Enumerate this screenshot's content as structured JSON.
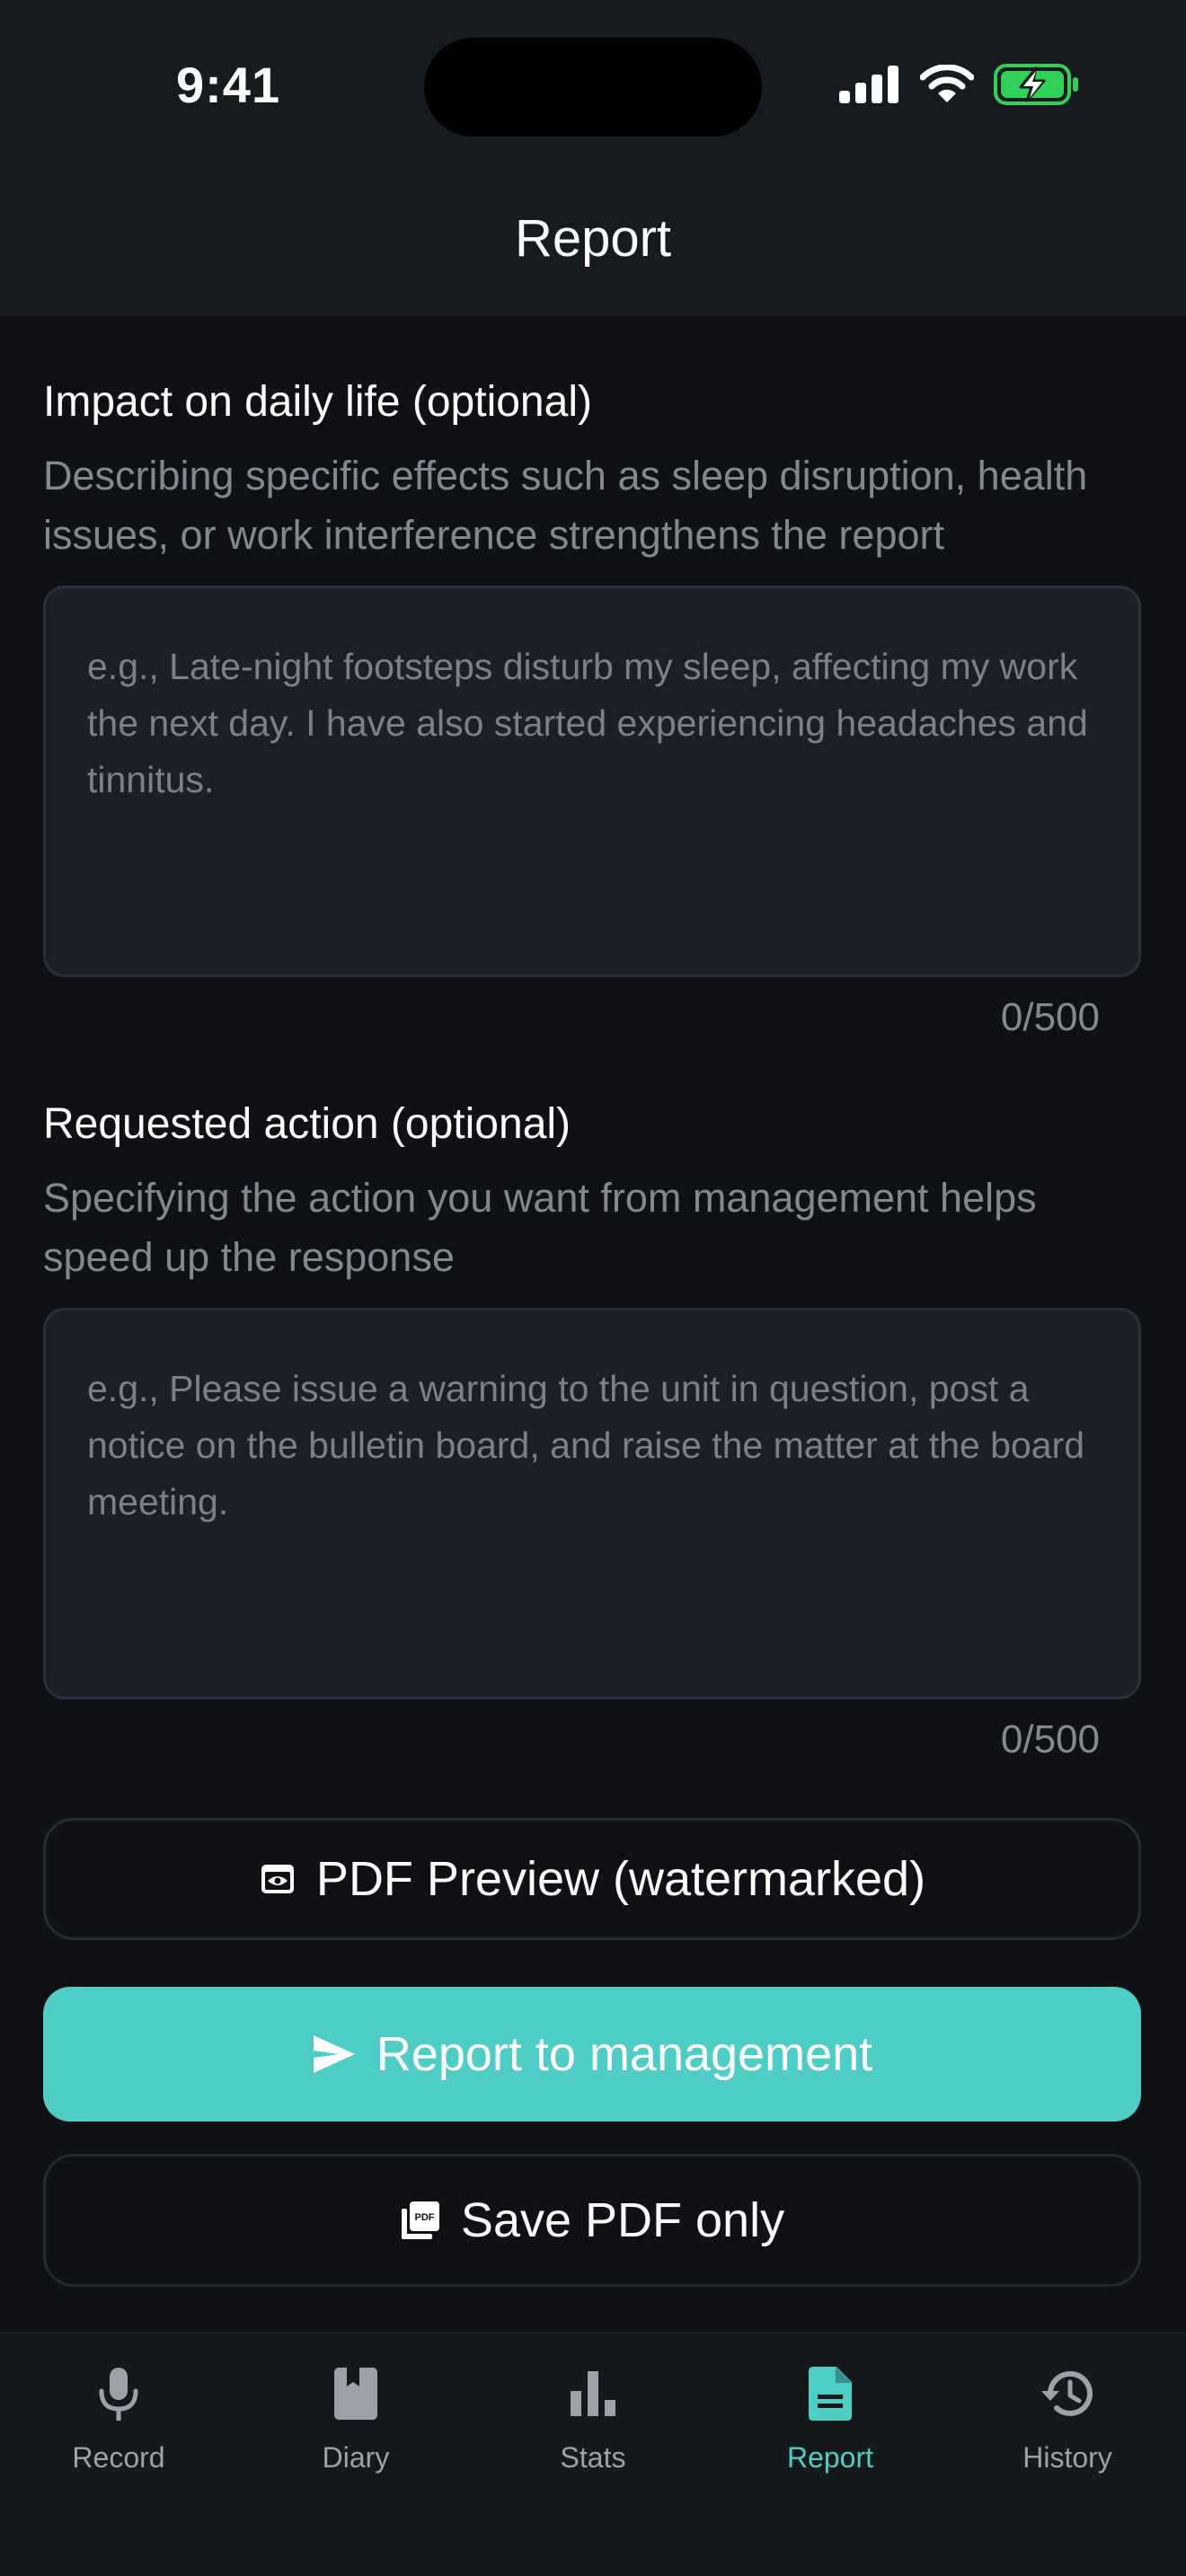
{
  "status_bar": {
    "time": "9:41"
  },
  "header": {
    "title": "Report"
  },
  "impact_section": {
    "title": "Impact on daily life (optional)",
    "help": "Describing specific effects such as sleep disruption, health issues, or work interference strengthens the report",
    "value": "",
    "placeholder": "e.g., Late-night footsteps disturb my sleep, affecting my work the next day. I have also started experiencing headaches and tinnitus.",
    "counter": "0/500"
  },
  "action_section": {
    "title": "Requested action (optional)",
    "help": "Specifying the action you want from management helps speed up the response",
    "value": "",
    "placeholder": "e.g., Please issue a warning to the unit in question, post a notice on the bulletin board, and raise the matter at the board meeting.",
    "counter": "0/500"
  },
  "buttons": {
    "preview": {
      "label": "PDF Preview (watermarked)",
      "icon": "eye-icon"
    },
    "report": {
      "label": "Report to management",
      "icon": "send-icon"
    },
    "save": {
      "label": "Save PDF only",
      "icon": "pdf-icon"
    }
  },
  "tabs": [
    {
      "label": "Record",
      "icon": "microphone-icon",
      "active": false
    },
    {
      "label": "Diary",
      "icon": "book-icon",
      "active": false
    },
    {
      "label": "Stats",
      "icon": "bar-chart-icon",
      "active": false
    },
    {
      "label": "Report",
      "icon": "document-icon",
      "active": true
    },
    {
      "label": "History",
      "icon": "history-icon",
      "active": false
    }
  ],
  "colors": {
    "background": "#0f1114",
    "header_background": "#151b1e",
    "accent": "#4ecdc4",
    "field_background": "#1d1f26",
    "muted_text": "#83878e",
    "tab_inactive": "#9ea2a8",
    "battery_green": "#30d158"
  }
}
